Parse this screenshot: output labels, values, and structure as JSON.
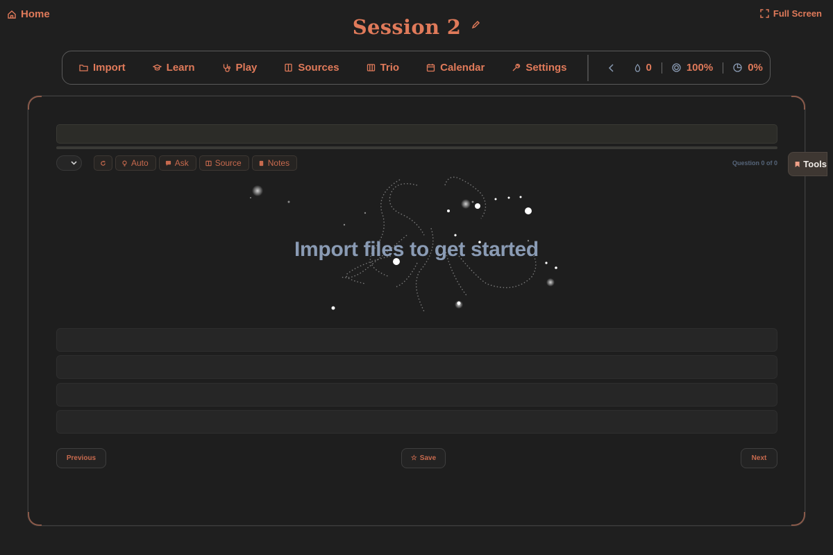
{
  "header": {
    "home_label": "Home",
    "fullscreen_label": "Full Screen",
    "session_title": "Session 2"
  },
  "nav": {
    "items": [
      {
        "label": "Import",
        "icon": "folder-icon"
      },
      {
        "label": "Learn",
        "icon": "graduation-cap-icon"
      },
      {
        "label": "Play",
        "icon": "stethoscope-icon"
      },
      {
        "label": "Sources",
        "icon": "book-icon"
      },
      {
        "label": "Trio",
        "icon": "columns-icon"
      },
      {
        "label": "Calendar",
        "icon": "calendar-icon"
      },
      {
        "label": "Settings",
        "icon": "wrench-icon"
      }
    ],
    "stats": {
      "count": "0",
      "accuracy": "100%",
      "progress": "0%"
    }
  },
  "toolbar": {
    "auto_label": "Auto",
    "ask_label": "Ask",
    "source_label": "Source",
    "notes_label": "Notes",
    "counter": "Question 0 of 0"
  },
  "tools_tab": {
    "label": "Tools"
  },
  "main": {
    "empty_message": "Import files to get started",
    "previous_label": "Previous",
    "save_label": "Save",
    "next_label": "Next"
  },
  "colors": {
    "accent": "#e07a5a",
    "background": "#1f1f1f",
    "message": "#8a9bb4"
  }
}
